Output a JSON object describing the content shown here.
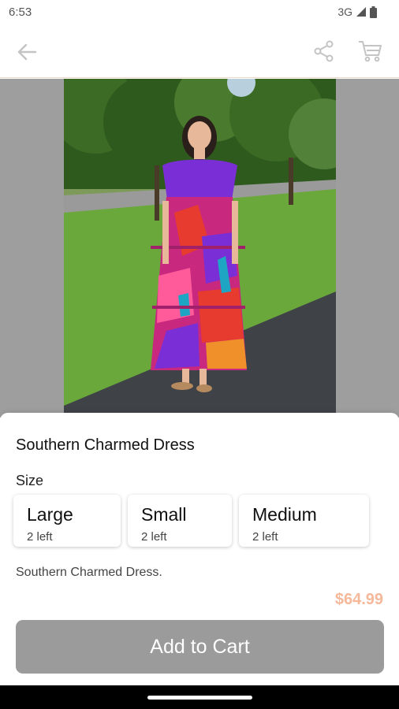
{
  "status_bar": {
    "time": "6:53",
    "network": "3G"
  },
  "app_bar": {
    "icons": [
      "back-arrow-icon",
      "share-icon",
      "cart-icon"
    ]
  },
  "product": {
    "title": "Southern Charmed Dress",
    "size_label": "Size",
    "sizes": [
      {
        "name": "Large",
        "stock": "2 left"
      },
      {
        "name": "Small",
        "stock": "2 left"
      },
      {
        "name": "Medium",
        "stock": "2 left"
      }
    ],
    "description": "Southern Charmed Dress.",
    "price": "$64.99",
    "add_to_cart_label": "Add to Cart"
  },
  "colors": {
    "price": "#f5b899",
    "button": "#9b9b9b",
    "accent_line": "#f0d8c8"
  }
}
